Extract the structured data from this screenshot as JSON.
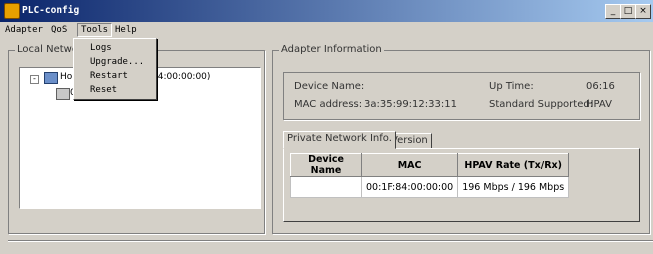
{
  "window": {
    "title": "PLC-config",
    "controls": {
      "minimize": "_",
      "maximize": "□",
      "close": "×"
    }
  },
  "menubar": {
    "items": [
      {
        "label": "Adapter"
      },
      {
        "label": "QoS"
      },
      {
        "label": "Tools"
      },
      {
        "label": "Help"
      }
    ]
  },
  "tools_menu": {
    "items": [
      {
        "label": "Logs"
      },
      {
        "label": "Upgrade..."
      },
      {
        "label": "Restart"
      },
      {
        "label": "Reset"
      }
    ]
  },
  "local_network": {
    "label": "Local Networ",
    "tree": {
      "root_label": "Home",
      "root_suffix": "84:00:00:00)",
      "child_label": "0"
    },
    "icons": [
      "expand-icon",
      "network-icon",
      "device-icon"
    ]
  },
  "adapter_info": {
    "label": "Adapter Information",
    "device_name_label": "Device Name:",
    "device_name_value": "",
    "uptime_label": "Up Time:",
    "uptime_value": "06:16",
    "mac_label": "MAC address:",
    "mac_value": "3a:35:99:12:33:11",
    "standard_label": "Standard Supported:",
    "standard_value": "HPAV"
  },
  "tabs": [
    {
      "label": "Private Network Info."
    },
    {
      "label": "Version"
    }
  ],
  "table": {
    "headers": [
      "Device Name",
      "MAC",
      "HPAV Rate (Tx/Rx)"
    ],
    "rows": [
      [
        "",
        "00:1F:84:00:00:00",
        "196 Mbps / 196 Mbps"
      ]
    ]
  },
  "colors": {
    "titlebar_start": "#0a246a",
    "titlebar_end": "#a6caf0",
    "face": "#d4d0c8"
  }
}
